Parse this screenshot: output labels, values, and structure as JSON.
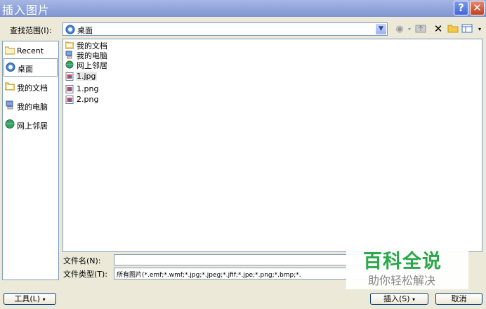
{
  "window": {
    "title": "插入图片",
    "help_symbol": "?",
    "close_symbol": "✕"
  },
  "lookin": {
    "label": "查找范围(I):",
    "value": "桌面"
  },
  "places": [
    {
      "label": "Recent",
      "icon": "folder-icon"
    },
    {
      "label": "桌面",
      "icon": "desktop-icon"
    },
    {
      "label": "我的文档",
      "icon": "documents-folder-icon"
    },
    {
      "label": "我的电脑",
      "icon": "computer-icon"
    },
    {
      "label": "网上邻居",
      "icon": "network-icon"
    }
  ],
  "files": [
    {
      "name": "我的文档",
      "icon": "documents-folder-icon"
    },
    {
      "name": "我的电脑",
      "icon": "computer-icon"
    },
    {
      "name": "网上邻居",
      "icon": "network-icon"
    },
    {
      "name": "1.jpg",
      "icon": "image-file-icon"
    },
    {
      "name": "1.png",
      "icon": "image-file-icon"
    },
    {
      "name": "2.png",
      "icon": "image-file-icon"
    }
  ],
  "filename": {
    "label": "文件名(N):",
    "value": ""
  },
  "filetype": {
    "label": "文件类型(T):",
    "value": "所有图片(*.emf;*.wmf;*.jpg;*.jpeg;*.jfif;*.jpe;*.png;*.bmp;*."
  },
  "buttons": {
    "tools": "工具(L)",
    "insert": "插入(S)",
    "cancel": "取消"
  },
  "watermark": {
    "line1": "百科全说",
    "line2": "助你轻松解决"
  },
  "colors": {
    "titlebar": "#8ea2d9",
    "dialog_bg": "#ece9d8",
    "border": "#7f9db9",
    "watermark_green": "#2aa84a"
  }
}
